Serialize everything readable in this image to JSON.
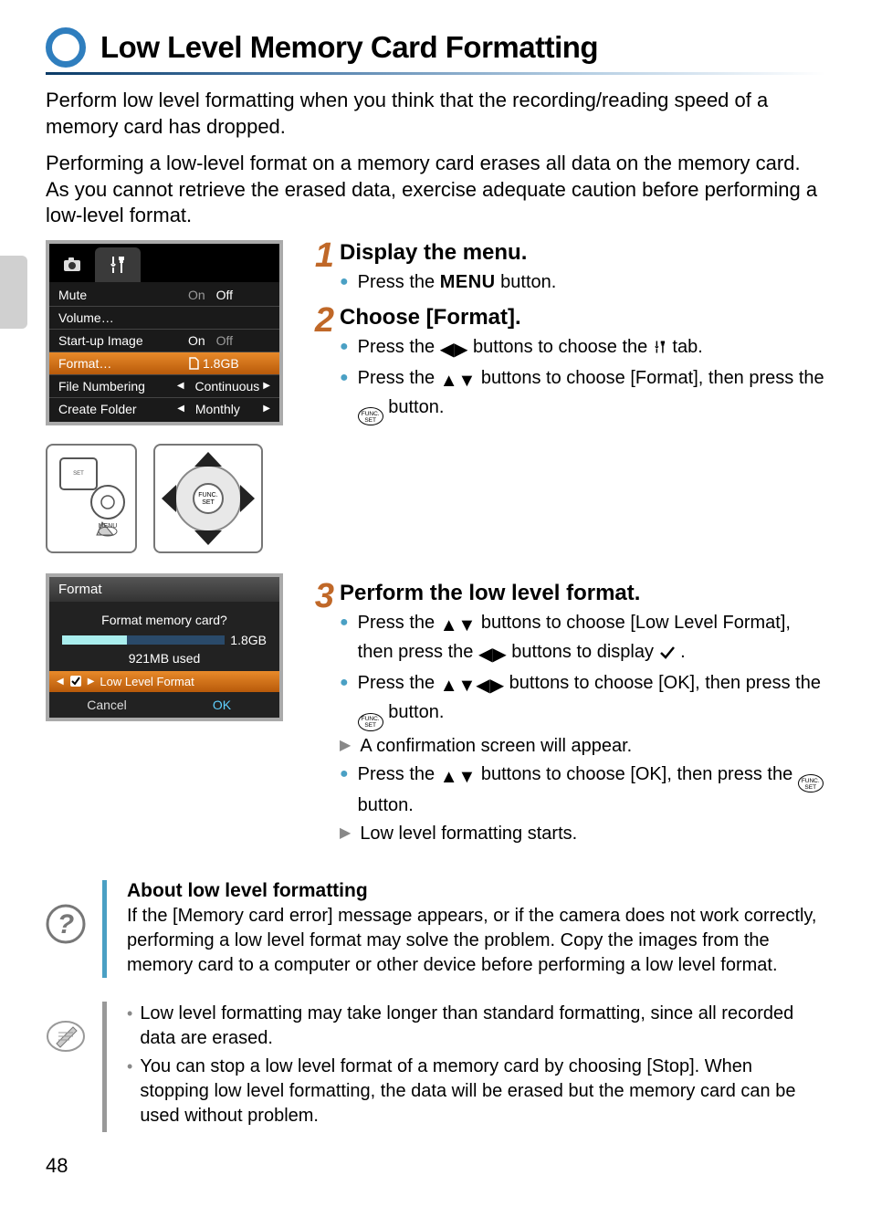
{
  "page_number": "48",
  "title": "Low Level Memory Card Formatting",
  "intro_p1": "Perform low level formatting when you think that the recording/reading speed of a memory card has dropped.",
  "intro_p2": "Performing a low-level format on a memory card erases all data on the memory card. As you cannot retrieve the erased data, exercise adequate caution before performing a low-level format.",
  "camera_menu": {
    "rows": [
      {
        "label": "Mute",
        "val_left": "On",
        "val_right": "Off",
        "selected": false,
        "right_active": true
      },
      {
        "label": "Volume…",
        "val_left": "",
        "val_right": "",
        "selected": false
      },
      {
        "label": "Start-up Image",
        "val_left": "On",
        "val_right": "Off",
        "selected": false,
        "left_active": true
      },
      {
        "label": "Format…",
        "val_left": "",
        "val_right": "1.8GB",
        "selected": true,
        "icon": "card"
      },
      {
        "label": "File Numbering",
        "val_left": "",
        "val_right": "Continuous",
        "selected": false,
        "arrows": true
      },
      {
        "label": "Create Folder",
        "val_left": "",
        "val_right": "Monthly",
        "selected": false,
        "arrows": true
      }
    ]
  },
  "format_dialog": {
    "header": "Format",
    "question": "Format memory card?",
    "capacity": "1.8GB",
    "used": "921MB used",
    "llf_label": "Low Level Format",
    "cancel": "Cancel",
    "ok": "OK"
  },
  "steps": {
    "s1": {
      "num": "1",
      "title": "Display the menu.",
      "l1a": "Press the ",
      "l1b": " button.",
      "menu_word": "MENU"
    },
    "s2": {
      "num": "2",
      "title": "Choose [Format].",
      "l1a": "Press the ",
      "l1b": " buttons to choose the ",
      "l1c": " tab.",
      "l2a": "Press the ",
      "l2b": " buttons to choose [Format], then press the ",
      "l2c": " button."
    },
    "s3": {
      "num": "3",
      "title": "Perform the low level format.",
      "l1a": "Press the ",
      "l1b": " buttons to choose [Low Level Format], then press the ",
      "l1c": " buttons to display ",
      "l1d": " .",
      "l2a": "Press the ",
      "l2b": " buttons to choose [OK], then press the ",
      "l2c": " button.",
      "l3": "A confirmation screen will appear.",
      "l4a": "Press the ",
      "l4b": " buttons to choose [OK], then press the ",
      "l4c": " button.",
      "l5": "Low level formatting starts."
    }
  },
  "about": {
    "title": "About low level formatting",
    "text": "If the [Memory card error] message appears, or if the camera does not work correctly, performing a low level format may solve the problem. Copy the images from the memory card to a computer or other device before performing a low level format."
  },
  "tips": {
    "t1": "Low level formatting may take longer than standard formatting, since all recorded data are erased.",
    "t2": "You can stop a low level format of a memory card by choosing [Stop]. When stopping low level formatting, the data will be erased but the memory card can be used without problem."
  }
}
